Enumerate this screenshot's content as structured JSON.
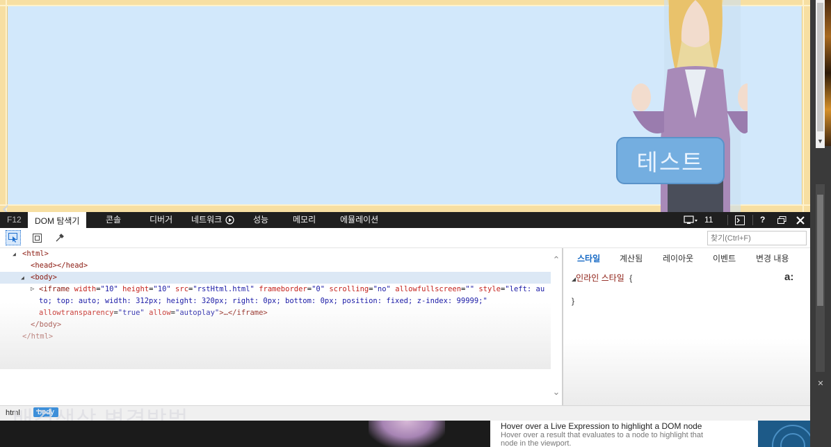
{
  "preview": {
    "button_label": "테스트"
  },
  "devtools": {
    "f12_label": "F12",
    "tabs": [
      "DOM 탐색기",
      "콘솔",
      "디버거",
      "네트워크",
      "성능",
      "메모리",
      "에뮬레이션"
    ],
    "right_controls": {
      "target_version": "11",
      "help": "?"
    },
    "find_placeholder": "찾기(Ctrl+F)",
    "dom": {
      "html_open": "<html>",
      "head": "<head></head>",
      "body_open": "<body>",
      "iframe_tag_open": "<iframe",
      "iframe_attrs": [
        {
          "name": "width",
          "value": "\"10\""
        },
        {
          "name": "height",
          "value": "\"10\""
        },
        {
          "name": "src",
          "value": "\"rstHtml.html\""
        },
        {
          "name": "frameborder",
          "value": "\"0\""
        },
        {
          "name": "scrolling",
          "value": "\"no\""
        },
        {
          "name": "allowfullscreen",
          "value": "\"\""
        },
        {
          "name": "style",
          "value": "\"left: au"
        }
      ],
      "iframe_style_cont": "to; top: auto; width: 312px; height: 320px; right: 0px; bottom: 0px; position: fixed; z-index: 99999;\"",
      "iframe_attrs_line3": [
        {
          "name": "allowtransparency",
          "value": "\"true\""
        },
        {
          "name": "allow",
          "value": "\"autoplay\""
        }
      ],
      "iframe_close": ">…</iframe>",
      "body_close": "</body>",
      "html_close": "</html>"
    },
    "styles": {
      "tabs": [
        "스타일",
        "계산됨",
        "레이아웃",
        "이벤트",
        "변경 내용"
      ],
      "inline_label": "인라인 스타일",
      "open_brace": "{",
      "close_brace": "}",
      "a_icon_label": "a:"
    },
    "breadcrumb": [
      "html",
      "body"
    ]
  },
  "caption": "배경색상 변경방법",
  "tooltip": {
    "title": "Hover over a Live Expression to highlight a DOM node",
    "subtitle_line1": "Hover over a result that evaluates to a node to highlight that",
    "subtitle_line2": "node in the viewport."
  }
}
